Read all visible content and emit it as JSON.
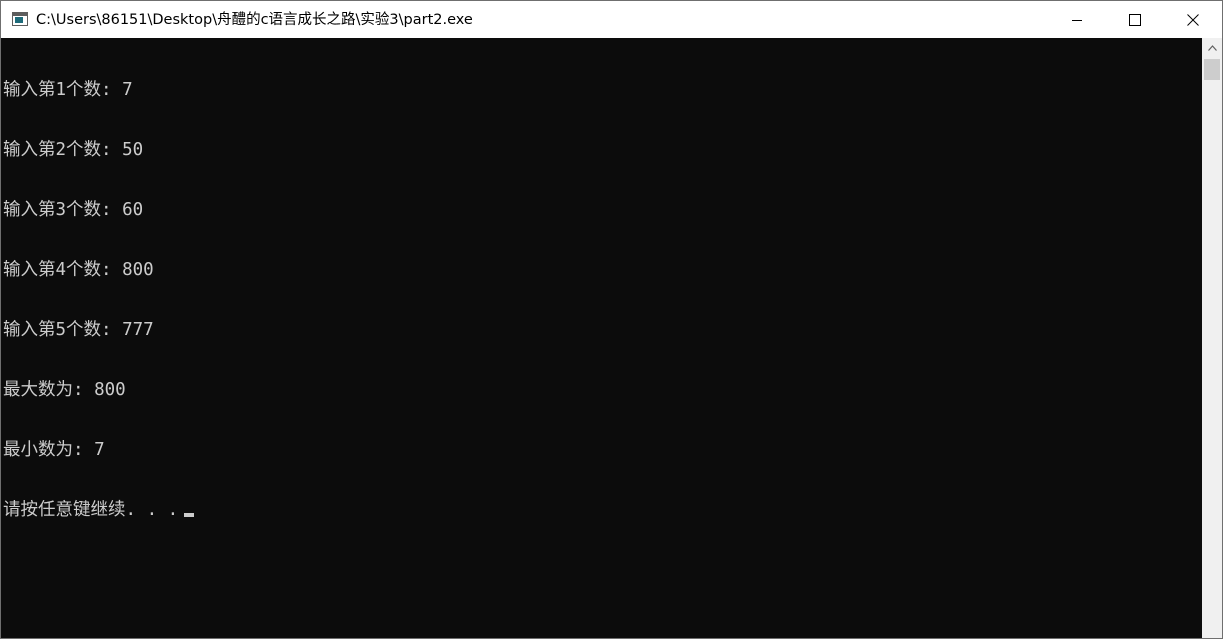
{
  "window": {
    "title": "C:\\Users\\86151\\Desktop\\舟醴的c语言成长之路\\实验3\\part2.exe",
    "controls": {
      "minimize_icon": "minimize-icon",
      "maximize_icon": "maximize-icon",
      "close_icon": "close-icon"
    }
  },
  "console": {
    "lines": [
      "输入第1个数: 7",
      "输入第2个数: 50",
      "输入第3个数: 60",
      "输入第4个数: 800",
      "输入第5个数: 777",
      "最大数为: 800",
      "最小数为: 7",
      "请按任意键继续. . ."
    ],
    "colors": {
      "background": "#0c0c0c",
      "foreground": "#cccccc"
    }
  },
  "scrollbar": {
    "up_icon": "chevron-up-icon"
  }
}
